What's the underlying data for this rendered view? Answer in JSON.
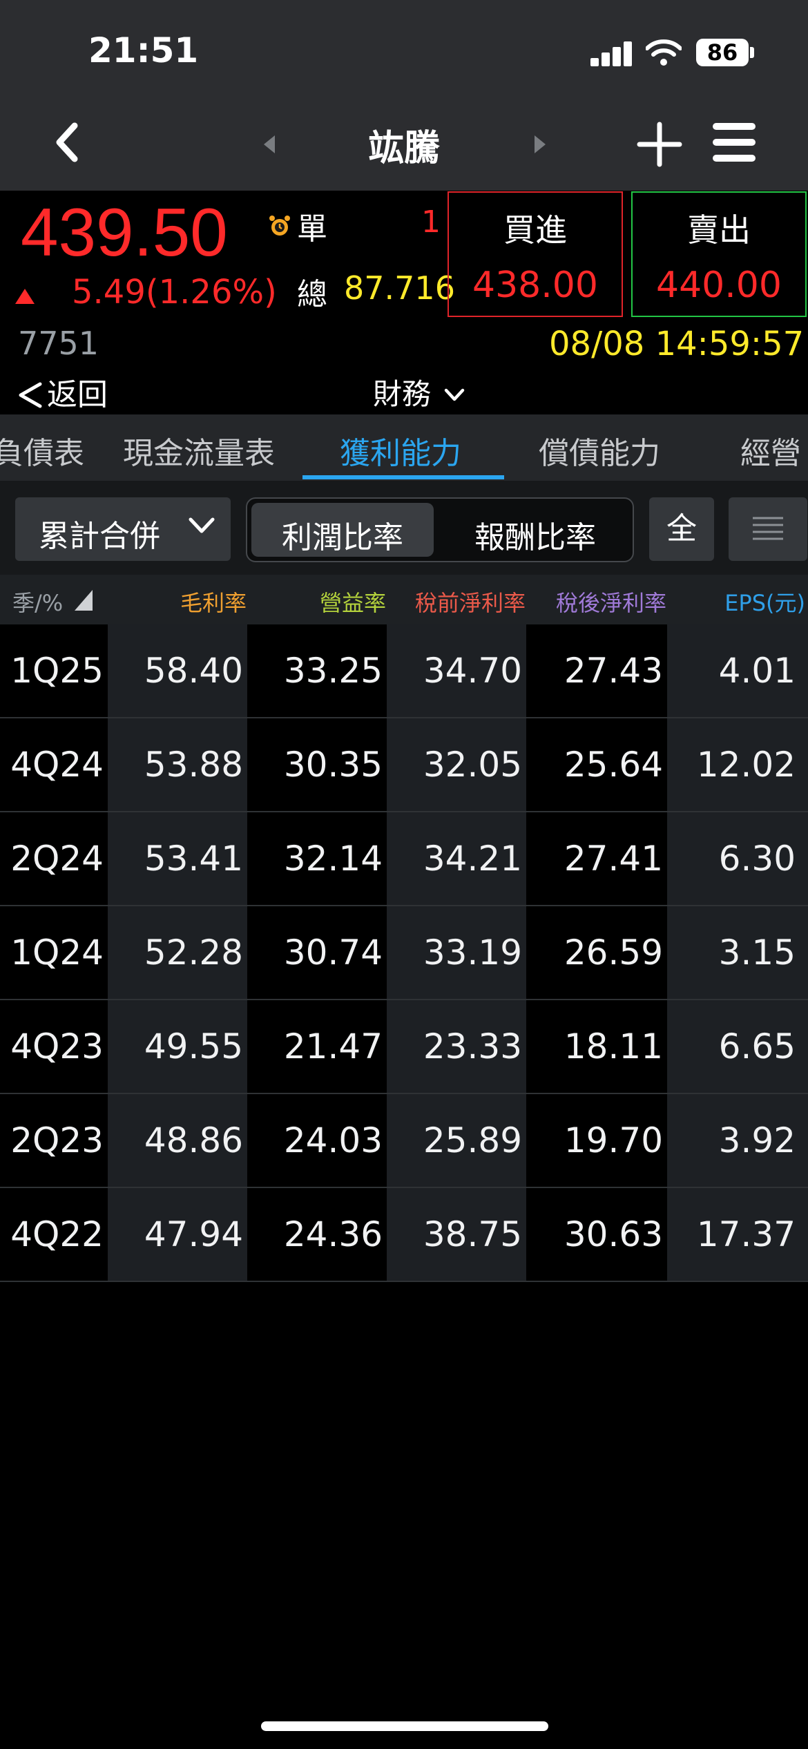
{
  "status_bar": {
    "time": "21:51",
    "battery": "86"
  },
  "nav": {
    "title": "竑騰"
  },
  "quote": {
    "price": "439.50",
    "change": "5.49(1.26%)",
    "single_label": "單",
    "single_value": "1",
    "total_label": "總",
    "total_value": "87.716",
    "buy_label": "買進",
    "buy_price": "438.00",
    "sell_label": "賣出",
    "sell_price": "440.00",
    "code": "7751",
    "datetime": "08/08 14:59:57",
    "back_label": "返回",
    "section_menu": "財務"
  },
  "tabs": [
    "負債表",
    "現金流量表",
    "獲利能力",
    "償債能力",
    "經營"
  ],
  "filters": {
    "dropdown": "累計合併",
    "segment_a": "利潤比率",
    "segment_b": "報酬比率",
    "all_button": "全"
  },
  "table": {
    "headers": [
      "季/%",
      "毛利率",
      "營益率",
      "稅前淨利率",
      "稅後淨利率",
      "EPS(元)"
    ],
    "rows": [
      [
        "1Q25",
        "58.40",
        "33.25",
        "34.70",
        "27.43",
        "4.01"
      ],
      [
        "4Q24",
        "53.88",
        "30.35",
        "32.05",
        "25.64",
        "12.02"
      ],
      [
        "2Q24",
        "53.41",
        "32.14",
        "34.21",
        "27.41",
        "6.30"
      ],
      [
        "1Q24",
        "52.28",
        "30.74",
        "33.19",
        "26.59",
        "3.15"
      ],
      [
        "4Q23",
        "49.55",
        "21.47",
        "23.33",
        "18.11",
        "6.65"
      ],
      [
        "2Q23",
        "48.86",
        "24.03",
        "25.89",
        "19.70",
        "3.92"
      ],
      [
        "4Q22",
        "47.94",
        "24.36",
        "38.75",
        "30.63",
        "17.37"
      ]
    ]
  },
  "colors": {
    "up_red": "#ff2a2a",
    "yellow": "#ffea2b",
    "tab_active": "#2ba6f0",
    "th_gross": "#f0a030",
    "th_operating": "#b4d23c",
    "th_pretax": "#ec5a4a",
    "th_aftertax": "#a07ad8",
    "th_eps": "#2f9fe8"
  }
}
